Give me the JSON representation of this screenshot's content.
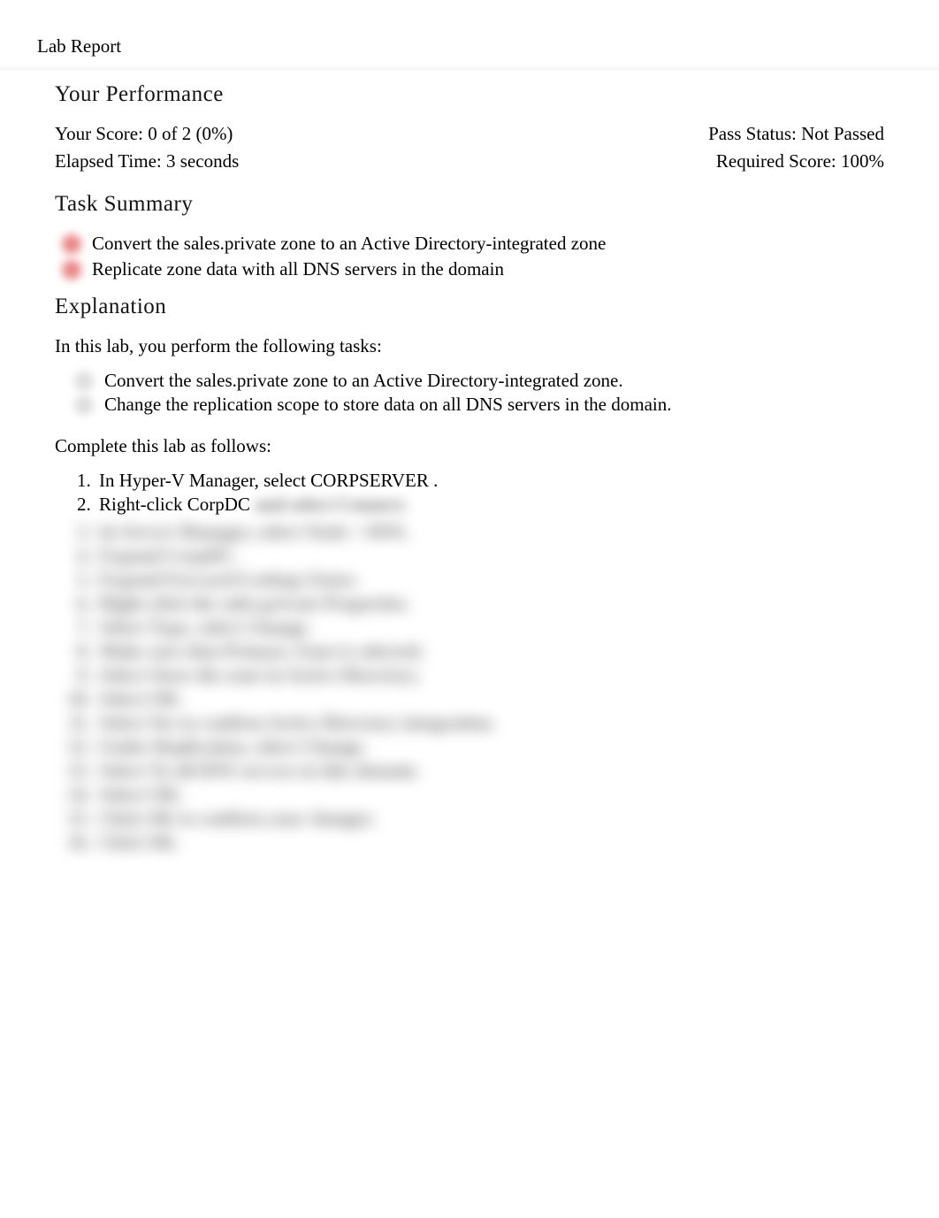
{
  "doc_title": "Lab Report",
  "sections": {
    "performance_heading": "Your Performance",
    "summary_heading": "Task Summary",
    "explanation_heading": "Explanation"
  },
  "performance": {
    "score_label": "Your Score: 0 of 2 (0%)",
    "pass_status_label": "Pass Status: Not Passed",
    "elapsed_label": "Elapsed Time: 3 seconds",
    "required_label": "Required Score: 100%"
  },
  "tasks": {
    "t1": "Convert the sales.private zone to an Active Directory-integrated zone",
    "t2": "Replicate zone data with all DNS servers in the domain"
  },
  "explanation_intro": "In this lab, you perform the following tasks:",
  "explanation_bullets": {
    "b1": "Convert the sales.private  zone to an Active Directory-integrated zone.",
    "b2": "Change the replication scope to store data on all DNS servers in the domain."
  },
  "complete_intro": "Complete this lab as follows:",
  "steps": {
    "s1": "In Hyper-V Manager, select CORPSERVER .",
    "s2_head": " Right-click CorpDC",
    "s2_tail": "and select Connect."
  },
  "obscured_steps": [
    "In Server Manager, select Tools > DNS.",
    "Expand CorpDC.",
    "Expand Forward Lookup Zones.",
    "Right-click the sales.private Properties.",
    "Select Type, select Change.",
    "Make sure that Primary Zone is selected.",
    "Select Store the zone in Active Directory.",
    "Select OK.",
    "Select Yes to confirm Active Directory integration.",
    "Under Replication, select Change.",
    "Select To all DNS servers in this domain.",
    "Select OK.",
    "Click OK to confirm your changes.",
    "Click OK."
  ]
}
